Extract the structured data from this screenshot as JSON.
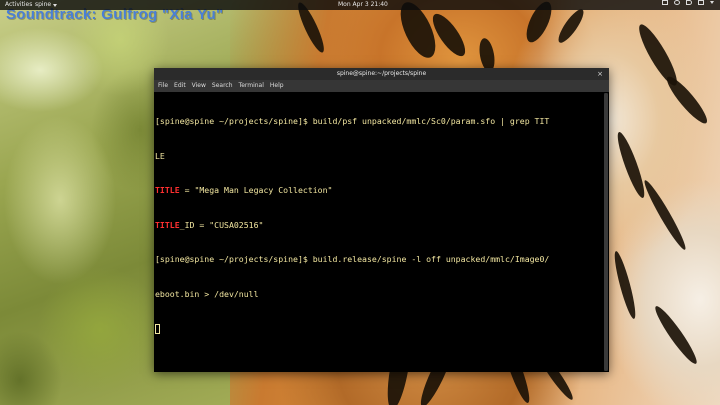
{
  "topbar": {
    "activities": "Activities",
    "app_menu": "spine",
    "clock": "Mon Apr 3  21:40"
  },
  "overlay": {
    "soundtrack": "Soundtrack: Gulfrog \"Xia Yu\""
  },
  "terminal": {
    "title": "spine@spine:~/projects/spine",
    "close_glyph": "×",
    "menu": [
      "File",
      "Edit",
      "View",
      "Search",
      "Terminal",
      "Help"
    ],
    "lines": {
      "l1": "[spine@spine ~/projects/spine]$ build/psf unpacked/mmlc/Sc0/param.sfo | grep TIT",
      "l2": "LE",
      "l3_key": "TITLE",
      "l3_val": " = \"Mega Man Legacy Collection\"",
      "l4_key": "TITLE",
      "l4_val": "_ID = \"CUSA02516\"",
      "l5": "[spine@spine ~/projects/spine]$ build.release/spine -l off unpacked/mmlc/Image0/",
      "l6": "eboot.bin > /dev/null"
    },
    "colors": {
      "text": "#f2e6a0",
      "highlight": "#ff3030",
      "background": "#000000"
    }
  }
}
